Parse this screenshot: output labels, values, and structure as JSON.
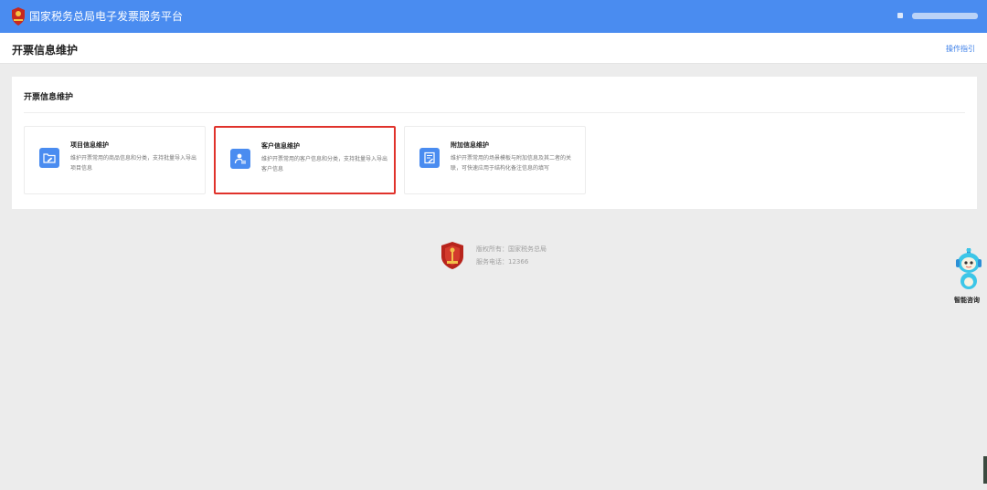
{
  "topbar": {
    "title": "国家税务总局电子发票服务平台"
  },
  "header": {
    "page_title": "开票信息维护",
    "guide_link": "操作指引"
  },
  "panel": {
    "title": "开票信息维护",
    "cards": [
      {
        "title": "项目信息维护",
        "description": "维护开票常用的商品信息和分类，支持批量导入导出项目信息",
        "icon": "folder-edit-icon"
      },
      {
        "title": "客户信息维护",
        "description": "维护开票常用的客户信息和分类，支持批量导入导出客户信息",
        "icon": "customer-card-icon",
        "selected": true
      },
      {
        "title": "附加信息维护",
        "description": "维护开票常用的场景模板与附加信息及其二者的关联，可快速应用于结构化备注信息的填写",
        "icon": "form-edit-icon"
      }
    ]
  },
  "footer": {
    "copyright": "版权所有：国家税务总局",
    "phone": "服务电话：12366"
  },
  "assistant": {
    "label": "智能咨询"
  },
  "colors": {
    "topbar": "#4a8cf0",
    "accent": "#4a8cf0",
    "selected_border": "#e0322b",
    "page_bg": "#ececec"
  }
}
